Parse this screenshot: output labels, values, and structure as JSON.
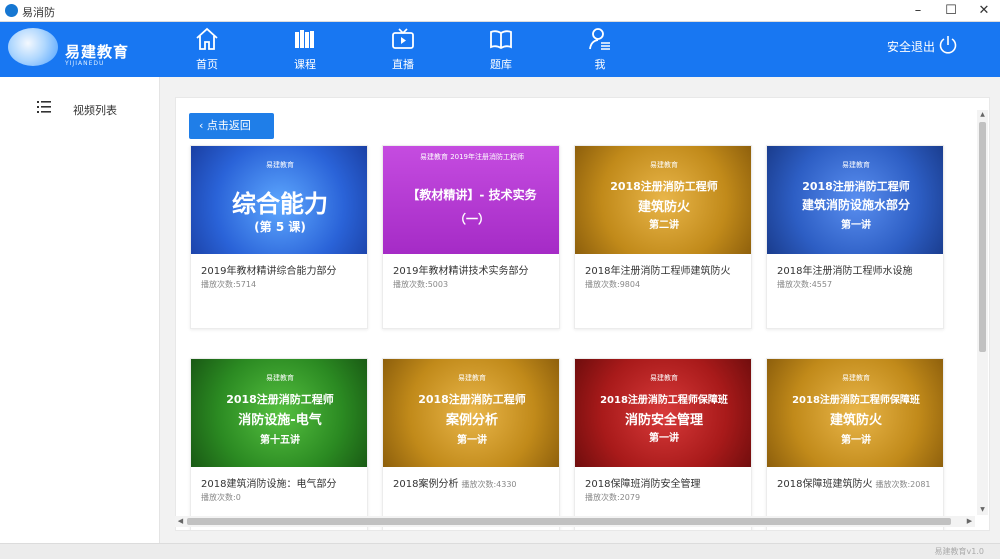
{
  "window": {
    "title": "易消防",
    "minimize": "–",
    "maximize": "☐",
    "close": "✕"
  },
  "brand": {
    "name": "易建教育",
    "sub": "YIJIANEDU"
  },
  "nav": [
    {
      "label": "首页",
      "icon": "home-icon"
    },
    {
      "label": "课程",
      "icon": "books-icon"
    },
    {
      "label": "直播",
      "icon": "tv-icon"
    },
    {
      "label": "题库",
      "icon": "book-open-icon"
    },
    {
      "label": "我",
      "icon": "user-icon"
    }
  ],
  "logout_label": "安全退出",
  "sidebar": {
    "items": [
      {
        "label": "视频列表",
        "icon": "list-icon"
      }
    ]
  },
  "back_label": "点击返回",
  "cards": [
    {
      "title": "2019年教材精讲综合能力部分",
      "plays": "播放次数:5714",
      "thumb_lines": [
        "综合能力",
        "(第 5 课)"
      ],
      "brand": "易建教育",
      "bg": "#2a63d8"
    },
    {
      "title": "2019年教材精讲技术实务部分",
      "plays": "播放次数:5003",
      "thumb_lines": [
        "【教材精讲】- 技术实务",
        "（一）"
      ],
      "brand": "易建教育  2019年注册消防工程师",
      "bg": "#b63bd4"
    },
    {
      "title": "2018年注册消防工程师建筑防火",
      "plays": "播放次数:9804",
      "thumb_lines": [
        "2018注册消防工程师",
        "建筑防火",
        "第二讲"
      ],
      "brand": "易建教育",
      "bg": "#c18a1a"
    },
    {
      "title": "2018年注册消防工程师水设施",
      "plays": "播放次数:4557",
      "thumb_lines": [
        "2018注册消防工程师",
        "建筑消防设施水部分",
        "第一讲"
      ],
      "brand": "易建教育",
      "bg": "#2d5ec4"
    },
    {
      "title": "2018建筑消防设施：电气部分",
      "plays": "播放次数:0",
      "thumb_lines": [
        "2018注册消防工程师",
        "消防设施-电气",
        "第十五讲"
      ],
      "brand": "易建教育",
      "bg": "#2b8a22"
    },
    {
      "title": "2018案例分析",
      "plays": "播放次数:4330",
      "thumb_lines": [
        "2018注册消防工程师",
        "案例分析",
        "第一讲"
      ],
      "brand": "易建教育",
      "bg": "#c18a1a"
    },
    {
      "title": "2018保障班消防安全管理",
      "plays": "播放次数:2079",
      "thumb_lines": [
        "2018注册消防工程师保障班",
        "消防安全管理",
        "第一讲"
      ],
      "brand": "易建教育",
      "bg": "#a81a1a"
    },
    {
      "title": "2018保障班建筑防火",
      "plays": "播放次数:2081",
      "thumb_lines": [
        "2018注册消防工程师保障班",
        "建筑防火",
        "第一讲"
      ],
      "brand": "易建教育",
      "bg": "#c18a1a"
    }
  ],
  "version": "易建教育v1.0"
}
